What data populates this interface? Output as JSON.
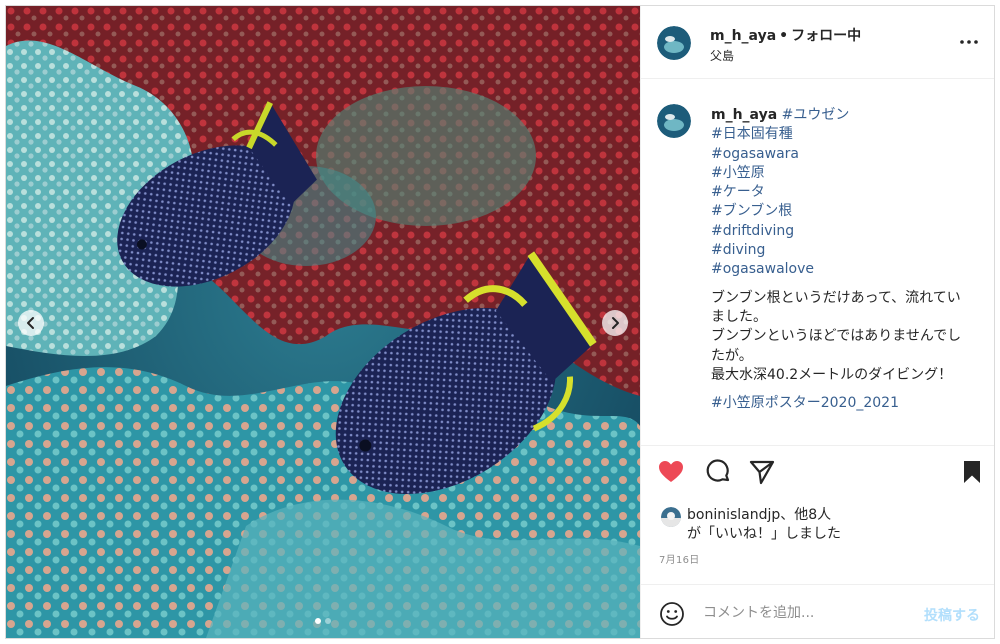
{
  "post": {
    "username": "m_h_aya",
    "separator": "•",
    "follow_status": "フォロー中",
    "location": "父島"
  },
  "caption": {
    "username": "m_h_aya",
    "first_tag": "#ユウゼン",
    "tags": [
      "#日本固有種",
      "#ogasawara",
      "#小笠原",
      "#ケータ",
      "#ブンブン根",
      "#driftdiving",
      "#diving",
      "#ogasawalove"
    ],
    "body_lines": [
      "ブンブン根というだけあって、流れてい",
      "ました。",
      "ブンブンというほどではありませんでし",
      "たが。",
      "最大水深40.2メートルのダイビング！"
    ],
    "last_tag": "#小笠原ポスター2020_2021"
  },
  "likes": {
    "users": "boninislandjp、他8人",
    "suffix": "が「いいね！」しました"
  },
  "date": "7月16日",
  "comment": {
    "placeholder": "コメントを追加...",
    "post_label": "投稿する"
  },
  "icons": {
    "like": "heart-icon",
    "comment": "comment-icon",
    "share": "share-icon",
    "save": "bookmark-icon",
    "more": "more-options-icon",
    "emoji": "emoji-icon",
    "prev": "chevron-left-icon",
    "next": "chevron-right-icon"
  },
  "colors": {
    "like_active": "#ed4956",
    "hashtag": "#385f8f",
    "post_disabled": "#b2dffc",
    "secondary_text": "#8e8e8e"
  },
  "carousel": {
    "count": 2,
    "active_index": 0
  }
}
